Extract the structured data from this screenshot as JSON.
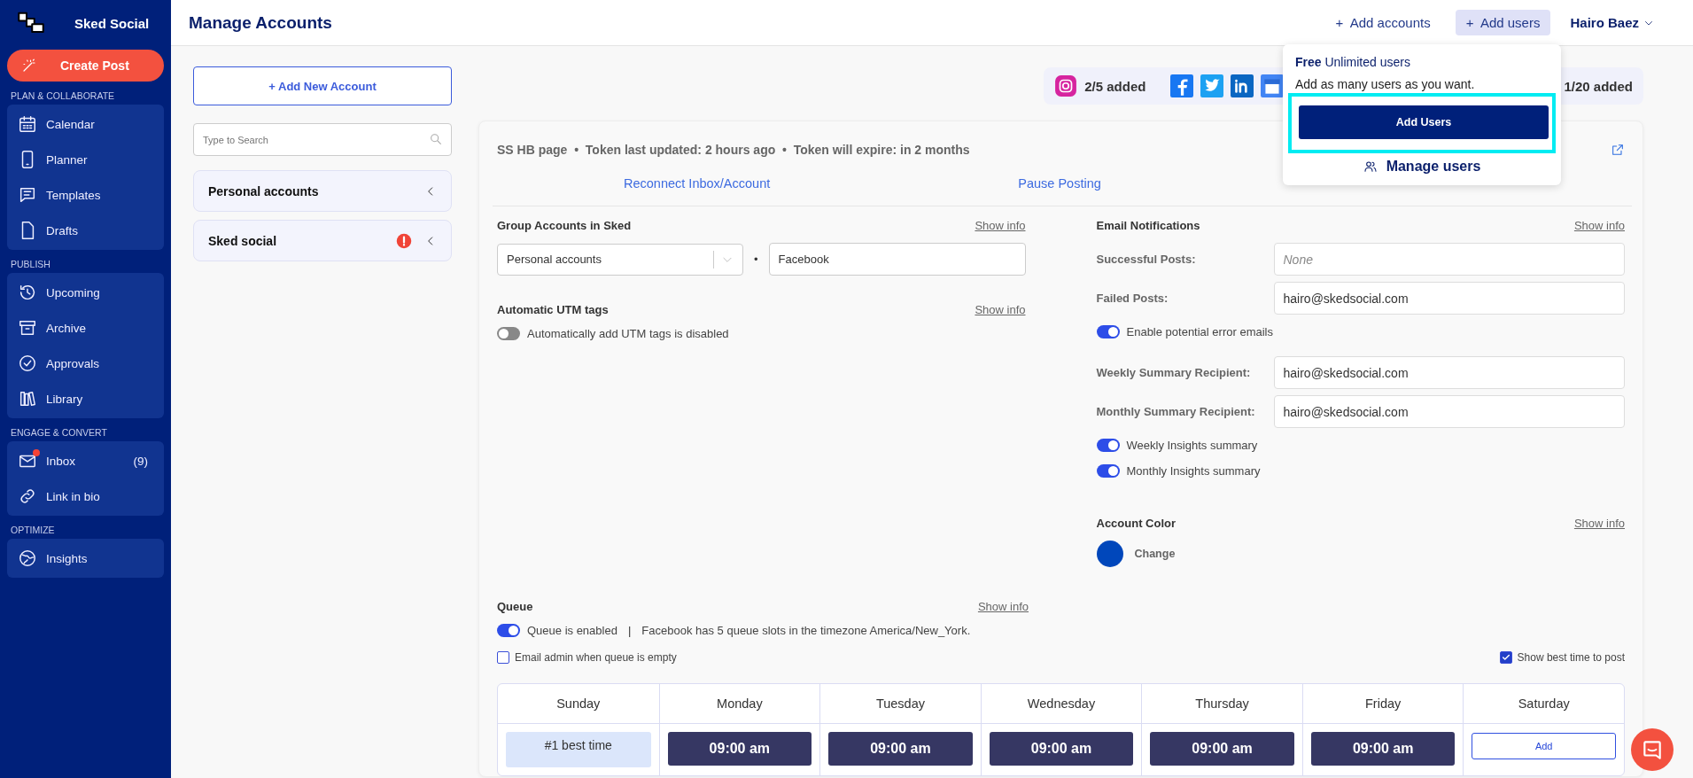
{
  "sidebar": {
    "brand": "Sked Social",
    "create_button": "Create Post",
    "sections": [
      {
        "title": "PLAN & COLLABORATE",
        "items": [
          {
            "label": "Calendar"
          },
          {
            "label": "Planner"
          },
          {
            "label": "Templates"
          },
          {
            "label": "Drafts"
          }
        ]
      },
      {
        "title": "PUBLISH",
        "items": [
          {
            "label": "Upcoming"
          },
          {
            "label": "Archive"
          },
          {
            "label": "Approvals"
          },
          {
            "label": "Library"
          }
        ]
      },
      {
        "title": "ENGAGE & CONVERT",
        "items": [
          {
            "label": "Inbox",
            "count": "(9)",
            "unread": true
          },
          {
            "label": "Link in bio"
          }
        ]
      },
      {
        "title": "OPTIMIZE",
        "items": [
          {
            "label": "Insights"
          }
        ]
      }
    ]
  },
  "header": {
    "title": "Manage Accounts",
    "actions": [
      {
        "label": "+  Add accounts",
        "selected": false
      },
      {
        "label": "+  Add users",
        "selected": true
      }
    ],
    "user": "Hairo Baez"
  },
  "accounts_panel": {
    "add_button": "+ Add New Account",
    "search": {
      "placeholder": "Type to Search"
    },
    "groups": [
      {
        "name": "Personal accounts",
        "alert": false
      },
      {
        "name": "Sked social",
        "alert": true
      }
    ]
  },
  "usage": [
    {
      "count": "2/5 added"
    },
    {
      "count": "1/20 added"
    }
  ],
  "users_menu": {
    "plan": "**Free** Unlimited users",
    "description": "Add as many users as you want.",
    "button": "Add Users",
    "link": "Manage users"
  },
  "account": {
    "meta": "SS HB page  •  Token last updated: 2 hours ago  •  Token will expire: in 2 months",
    "actions": [
      "Reconnect Inbox/Account",
      "Pause Posting"
    ]
  },
  "group_accounts": {
    "title": "Group Accounts in Sked",
    "show_info": "Show info",
    "group": "Personal accounts",
    "separator": "•",
    "name": "Facebook"
  },
  "utm": {
    "title": "Automatic UTM tags",
    "show_info": "Show info",
    "toggle": {
      "label": "Automatically add UTM tags is disabled",
      "on": false
    }
  },
  "email_notifications": {
    "title": "Email Notifications",
    "show_info": "Show info",
    "rows": [
      {
        "kind": "field",
        "label": "Successful Posts:",
        "placeholder": "None"
      },
      {
        "kind": "field",
        "label": "Failed Posts:",
        "value": "hairo@skedsocial.com"
      },
      {
        "kind": "toggle",
        "label": "Enable potential error emails",
        "on": true
      },
      {
        "kind": "field",
        "label": "Weekly Summary Recipient:",
        "value": "hairo@skedsocial.com"
      },
      {
        "kind": "field",
        "label": "Monthly Summary Recipient:",
        "value": "hairo@skedsocial.com"
      },
      {
        "kind": "toggle",
        "label": "Weekly Insights summary",
        "on": true
      },
      {
        "kind": "toggle",
        "label": "Monthly Insights summary",
        "on": true
      }
    ]
  },
  "account_color": {
    "title": "Account Color",
    "show_info": "Show info",
    "color": "#0047bb",
    "button": "Change"
  },
  "queue": {
    "title": "Queue",
    "show_info": "Show info",
    "toggle": {
      "label": "Queue is enabled",
      "on": true
    },
    "separator": "|",
    "info": "Facebook has 5 queue slots in the timezone America/New_York.",
    "email_admin": {
      "label": "Email admin when queue is empty",
      "checked": false
    },
    "best_time": {
      "label": "Show best time to post",
      "checked": true
    },
    "days": [
      {
        "name": "Sunday",
        "slots": [
          {
            "kind": "best",
            "text": "#1 best time"
          }
        ]
      },
      {
        "name": "Monday",
        "slots": [
          {
            "kind": "time",
            "text": "09:00 am"
          }
        ]
      },
      {
        "name": "Tuesday",
        "slots": [
          {
            "kind": "time",
            "text": "09:00 am"
          }
        ]
      },
      {
        "name": "Wednesday",
        "slots": [
          {
            "kind": "time",
            "text": "09:00 am"
          }
        ]
      },
      {
        "name": "Thursday",
        "slots": [
          {
            "kind": "time",
            "text": "09:00 am"
          }
        ]
      },
      {
        "name": "Friday",
        "slots": [
          {
            "kind": "time",
            "text": "09:00 am"
          }
        ]
      },
      {
        "name": "Saturday",
        "slots": [
          {
            "kind": "add",
            "text": "Add"
          }
        ]
      }
    ]
  }
}
